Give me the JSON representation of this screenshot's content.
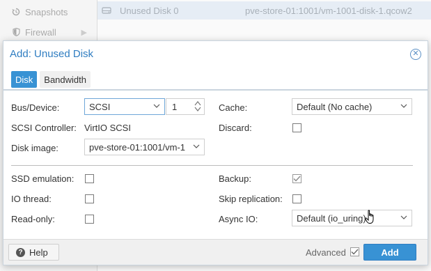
{
  "background": {
    "sidebar": [
      {
        "label": "Snapshots",
        "icon": "history-icon"
      },
      {
        "label": "Firewall",
        "icon": "shield-icon"
      }
    ],
    "row": {
      "name": "Unused Disk 0",
      "value": "pve-store-01:1001/vm-1001-disk-1.qcow2"
    }
  },
  "dialog": {
    "title": "Add: Unused Disk",
    "tabs": [
      {
        "label": "Disk",
        "active": true
      },
      {
        "label": "Bandwidth",
        "active": false
      }
    ],
    "form": {
      "bus_device_label": "Bus/Device:",
      "bus_value": "SCSI",
      "device_index": "1",
      "scsi_controller_label": "SCSI Controller:",
      "scsi_controller_value": "VirtIO SCSI",
      "disk_image_label": "Disk image:",
      "disk_image_value": "pve-store-01:1001/vm-1",
      "cache_label": "Cache:",
      "cache_value": "Default (No cache)",
      "discard_label": "Discard:",
      "discard_checked": false,
      "ssd_label": "SSD emulation:",
      "ssd_checked": false,
      "iothread_label": "IO thread:",
      "iothread_checked": false,
      "readonly_label": "Read-only:",
      "readonly_checked": false,
      "backup_label": "Backup:",
      "backup_checked": true,
      "skiprep_label": "Skip replication:",
      "skiprep_checked": false,
      "asyncio_label": "Async IO:",
      "asyncio_value": "Default (io_uring)"
    },
    "footer": {
      "help_label": "Help",
      "advanced_label": "Advanced",
      "advanced_checked": true,
      "add_label": "Add"
    }
  },
  "colors": {
    "accent": "#3892d4",
    "title": "#2f7dc1"
  }
}
